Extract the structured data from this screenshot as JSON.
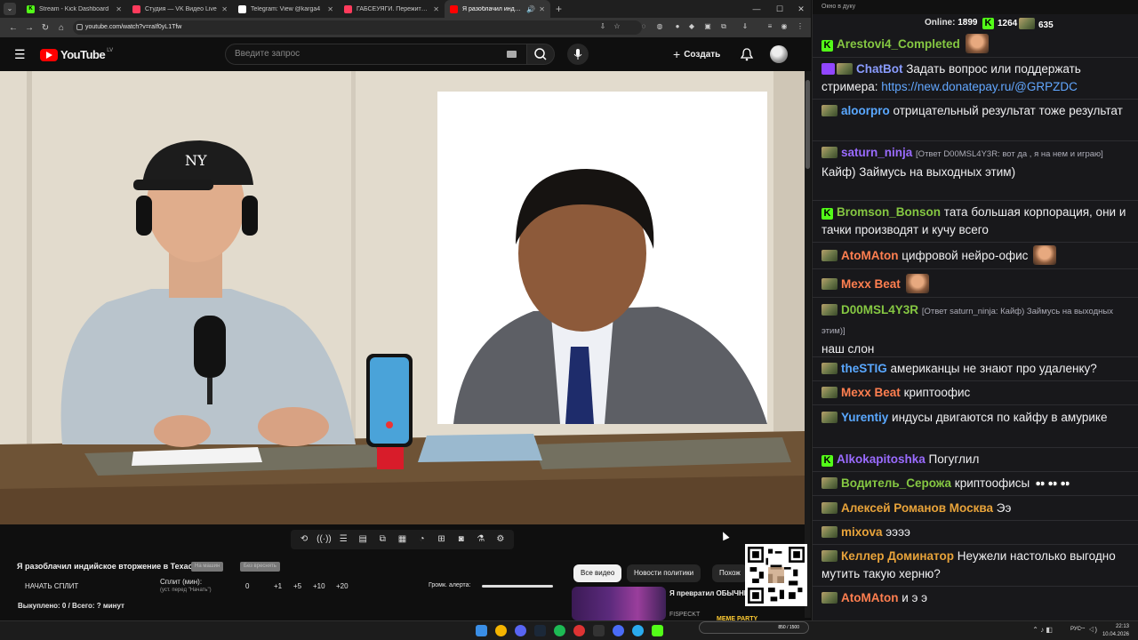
{
  "browser": {
    "tabs": [
      {
        "title": "Stream - Kick Dashboard",
        "fav": "#53fc18",
        "fav_letter": "K",
        "active": false
      },
      {
        "title": "Студия — VK Видео Live",
        "fav": "#ff3b5c",
        "fav_letter": "",
        "active": false
      },
      {
        "title": "Telegram: View @karga4",
        "fav": "#ffffff",
        "fav_letter": "",
        "active": false
      },
      {
        "title": "ГАБСЕУЯГИ. Пережить индейст...",
        "fav": "#ff3b5c",
        "fav_letter": "",
        "active": false
      },
      {
        "title": "Я разоблачил индийское",
        "fav": "#ff0000",
        "fav_letter": "",
        "active": true
      }
    ],
    "url": "youtube.com/watch?v=raIf0yL1Tfw"
  },
  "youtube": {
    "logo_text": "YouTube",
    "country": "LV",
    "search_placeholder": "Введите запрос",
    "create_label": "Создать"
  },
  "below": {
    "video_title": "Я разоблачил индийское вторжение в Техас...",
    "pill1": "На машин",
    "pill2": "Без вреснять",
    "start_split": "НАЧАТЬ СПЛИТ",
    "split_min_label": "Сплит (мин):",
    "split_min_sub": "(уст. перед \"Начать\")",
    "split_value": "0",
    "split_buttons": [
      "+1",
      "+5",
      "+10",
      "+20"
    ],
    "alert_volume": "Громк. алерта:",
    "paid": "Выкуплено: 0 / Всего: ? минут",
    "chips": [
      "Все видео",
      "Новости политики",
      "Похож"
    ],
    "rec_title": "Я превратил ОБЫЧНЫЙ БАЛКОН в ГЕЙМЕРСКИЙ",
    "rec_title_line2": "БАЛКОН в ГЕЙМЕРС",
    "rec_channel": "FISPECKT"
  },
  "chat": {
    "window_title": "Окно в дуку",
    "online_label": "Online:",
    "online_count": "1899",
    "kick_count": "1264",
    "vk_count": "635",
    "messages": [
      {
        "badge": "kick",
        "user": "Arestovi4_Completed",
        "color": "#85c742",
        "text": "",
        "emote": true
      },
      {
        "badge": "bot",
        "user": "ChatBot",
        "color": "#8a9cff",
        "text": "Задать вопрос или поддержать стримера: ",
        "link": "https://new.donatepay.ru/@GRPZDC"
      },
      {
        "badge": "av",
        "user": "aloorpro",
        "color": "#5aa8ff",
        "text": "отрицательный результат тоже результат"
      },
      {
        "badge": "av",
        "user": "saturn_ninja",
        "color": "#9a6bff",
        "reply": "[Ответ D00MSL4Y3R: вот да , я на нем и играю]",
        "text": "Кайф) Займусь на выходных этим)"
      },
      {
        "badge": "kick",
        "user": "Bromson_Bonson",
        "color": "#85c742",
        "text": "тата большая корпорация, они и тачки производят и кучу всего"
      },
      {
        "badge": "av",
        "user": "AtoMAton",
        "color": "#ff7f50",
        "text": "цифровой нейро-офис",
        "emote": true
      },
      {
        "badge": "av",
        "user": "Mexx Beat",
        "color": "#ff7f50",
        "text": "",
        "emote": true
      },
      {
        "badge": "av",
        "user": "D00MSL4Y3R",
        "color": "#85c742",
        "reply": "[Ответ saturn_ninja: Кайф) Займусь на выходных этим)]",
        "text": "наш слон"
      },
      {
        "badge": "av",
        "user": "theSTIG",
        "color": "#5aa8ff",
        "text": "американцы не знают про удаленку?"
      },
      {
        "badge": "av",
        "user": "Mexx Beat",
        "color": "#ff7f50",
        "text": "криптоофис"
      },
      {
        "badge": "av",
        "user": "Yurentiy",
        "color": "#5aa8ff",
        "text": "индусы двигаются по кайфу в амурике"
      },
      {
        "badge": "kick",
        "user": "Alkokapitoshka",
        "color": "#9a6bff",
        "text": "Погуглил"
      },
      {
        "badge": "av",
        "user": "Водитель_Серожа",
        "color": "#85c742",
        "text": "криптоофисы",
        "eyes": true
      },
      {
        "badge": "av",
        "user": "Алексей Романов Москва",
        "color": "#e8a33a",
        "text": "Ээ"
      },
      {
        "badge": "av",
        "user": "mixova",
        "color": "#e8a33a",
        "text": "ээээ"
      },
      {
        "badge": "av",
        "user": "Келлер Доминатор",
        "color": "#e8a33a",
        "text": "Неужели настолько выгодно мутить такую херню?"
      },
      {
        "badge": "av",
        "user": "AtoMAton",
        "color": "#ff7f50",
        "text": "и э э"
      }
    ]
  },
  "taskbar": {
    "lang": "РУС",
    "time": "22:13",
    "date": "10.04.2026",
    "meme_label": "MEME PARTY",
    "meme_progress": "850 / 1500"
  },
  "colors": {
    "kick": "#53fc18",
    "youtube_red": "#ff0000",
    "chat_bg": "#18181b"
  }
}
